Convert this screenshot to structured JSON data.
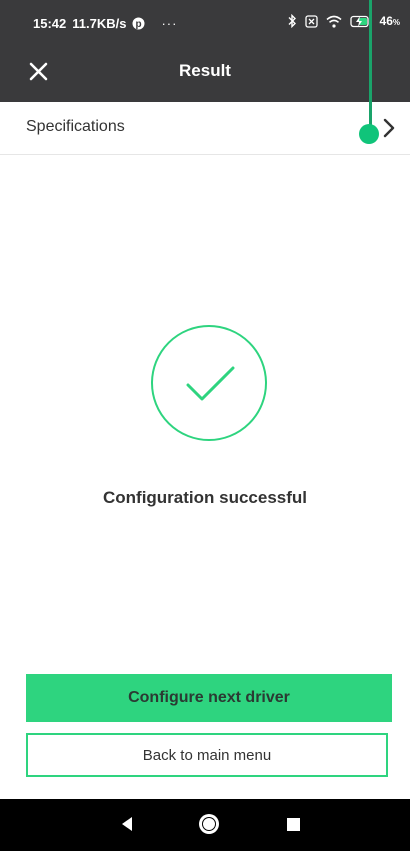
{
  "status_bar": {
    "time": "15:42",
    "speed": "11.7KB/s",
    "overflow": "···",
    "battery": "46",
    "battery_unit": "%"
  },
  "app_bar": {
    "title": "Result",
    "close_icon": "close-icon"
  },
  "specifications": {
    "label": "Specifications",
    "icon": "chevron-right-icon"
  },
  "result": {
    "message": "Configuration successful",
    "icon": "checkmark-circle-icon"
  },
  "actions": {
    "primary_label": "Configure next driver",
    "secondary_label": "Back to main menu"
  },
  "colors": {
    "accent": "#2ed47f",
    "bar": "#3a3a3c",
    "marker": "#10c47a"
  }
}
